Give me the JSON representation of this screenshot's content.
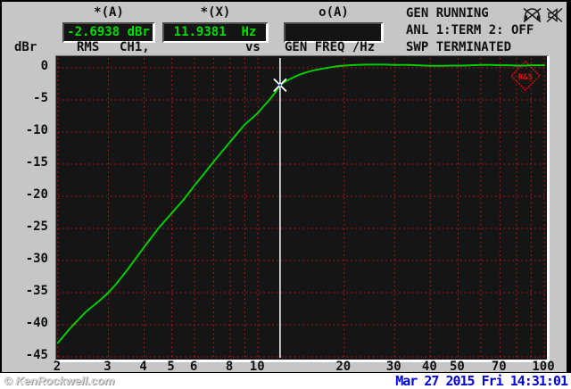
{
  "panel": {
    "unit_label": "dBr",
    "trace_labels": {
      "function": "RMS",
      "channel": "CH1,",
      "vs": "vs",
      "x_source": "GEN FREQ /Hz"
    },
    "readouts": [
      {
        "header": "*(A)",
        "value": "-2.6938 dBr"
      },
      {
        "header": "*(X)",
        "value": "11.9381  Hz"
      },
      {
        "header": "o(A)",
        "value": ""
      }
    ],
    "status_lines": [
      "GEN RUNNING",
      "ANL 1:TERM 2: OFF",
      "SWP TERMINATED"
    ],
    "icons": [
      "headphones-muted-icon",
      "speaker-muted-icon"
    ],
    "logo_text": "R&S",
    "colors": {
      "panel_bg": "#c6c6c6",
      "readout_text": "#00dd00",
      "plot_bg": "#151515",
      "grid": "#d51515",
      "curve": "#00cc00",
      "cursor": "#ffffff",
      "marker_center": "#3355ff",
      "logo": "#e01010",
      "date_text": "#0000d8"
    }
  },
  "chart_data": {
    "type": "line",
    "title": "",
    "xlabel": "GEN FREQ /Hz",
    "ylabel": "dBr",
    "x_scale": "log",
    "xlim": [
      2,
      100
    ],
    "ylim": [
      -45,
      1.5
    ],
    "grid": true,
    "legend": "none",
    "x_ticks": [
      2,
      3,
      4,
      5,
      6,
      8,
      10,
      20,
      30,
      40,
      50,
      70,
      100
    ],
    "x_gridlines": [
      2,
      3,
      4,
      5,
      6,
      7,
      8,
      9,
      10,
      20,
      30,
      40,
      50,
      60,
      70,
      80,
      90,
      100
    ],
    "y_ticks": [
      0,
      -5,
      -10,
      -15,
      -20,
      -25,
      -30,
      -35,
      -40,
      -45
    ],
    "grid_color": "#d51515",
    "background": "#151515",
    "series": [
      {
        "name": "RMS CH1 level vs GEN FREQ",
        "color": "#00cc00",
        "points": [
          [
            2,
            -42.8
          ],
          [
            2.2,
            -40.6
          ],
          [
            2.5,
            -38.0
          ],
          [
            2.8,
            -36.2
          ],
          [
            3,
            -35.0
          ],
          [
            3.2,
            -33.6
          ],
          [
            3.5,
            -31.4
          ],
          [
            4,
            -27.9
          ],
          [
            4.5,
            -24.9
          ],
          [
            5,
            -22.6
          ],
          [
            5.5,
            -20.5
          ],
          [
            6,
            -18.3
          ],
          [
            6.5,
            -16.4
          ],
          [
            7,
            -14.6
          ],
          [
            7.5,
            -13.0
          ],
          [
            8,
            -11.5
          ],
          [
            8.5,
            -10.1
          ],
          [
            9,
            -8.8
          ],
          [
            9.5,
            -7.9
          ],
          [
            10,
            -7.0
          ],
          [
            10.5,
            -5.9
          ],
          [
            11,
            -4.9
          ],
          [
            11.5,
            -3.8
          ],
          [
            11.9381,
            -2.6938
          ],
          [
            12.5,
            -2.1
          ],
          [
            13,
            -1.7
          ],
          [
            13.5,
            -1.35
          ],
          [
            14,
            -1.05
          ],
          [
            15,
            -0.6
          ],
          [
            16,
            -0.3
          ],
          [
            17,
            -0.1
          ],
          [
            18,
            0.1
          ],
          [
            19,
            0.25
          ],
          [
            20,
            0.35
          ],
          [
            22,
            0.45
          ],
          [
            24,
            0.5
          ],
          [
            26,
            0.5
          ],
          [
            28,
            0.5
          ],
          [
            30,
            0.45
          ],
          [
            33,
            0.45
          ],
          [
            36,
            0.4
          ],
          [
            40,
            0.3
          ],
          [
            44,
            0.3
          ],
          [
            48,
            0.35
          ],
          [
            52,
            0.35
          ],
          [
            56,
            0.4
          ],
          [
            60,
            0.45
          ],
          [
            65,
            0.45
          ],
          [
            70,
            0.4
          ],
          [
            75,
            0.4
          ],
          [
            80,
            0.35
          ],
          [
            85,
            0.35
          ],
          [
            90,
            0.4
          ],
          [
            95,
            0.4
          ],
          [
            100,
            0.4
          ]
        ]
      }
    ],
    "cursor": {
      "x_hz": 11.9381,
      "y_dbr": -2.6938
    }
  },
  "footer": {
    "watermark": "© KenRockwell.com",
    "datetime": "Mar 27 2015 Fri 14:31:01"
  }
}
